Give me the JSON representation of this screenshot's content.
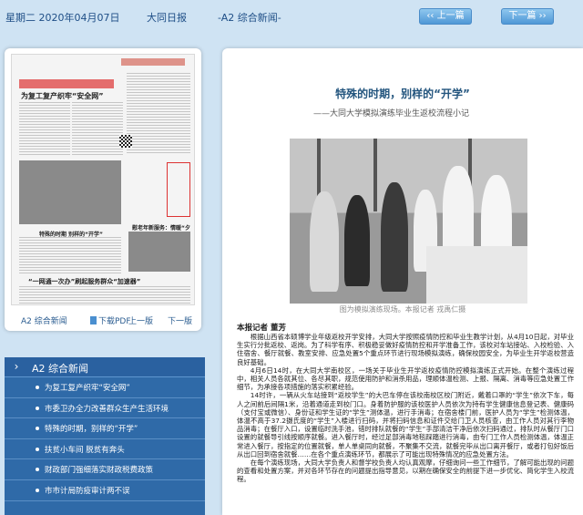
{
  "topbar": {
    "date": "星期二 2020年04月07日",
    "paper": "大同日报",
    "section": "-A2 综合新闻-",
    "prev_label": "上一篇",
    "next_label": "下一篇"
  },
  "thumbnail": {
    "page_name": "A2 综合新闻",
    "pdf_label": "下载PDF",
    "prev_page": "上一版",
    "next_page": "下一版",
    "headlines": [
      "为复工复产织牢“安全网”",
      "“一网通一次办”刷起服务群众“加速器”",
      "特殊的时期 别样的“开学”",
      "慰老年新服务：情暖“夕阳红”"
    ]
  },
  "sections": {
    "title": "A2 综合新闻",
    "items": [
      "为复工复产织牢“安全网”",
      "市委卫办全力改善群众生产生活环境",
      "特殊的时期，别样的“开学”",
      "扶贫小车间 脱贫有奔头",
      "财政部门强细落实财政税费政策",
      "市市计局防疫审计两不误"
    ]
  },
  "article": {
    "title": "特殊的时期，别样的“开学”",
    "subtitle": "——大同大学模拟演练毕业生返校流程小记",
    "caption": "图为模拟演练现场。本报记者 戎禹仁摄",
    "byline": "本报记者 董芳",
    "paragraphs": [
      "根据山西省本硕博学业年级返校开学安排，大同大学按照疫情防控和毕业生教学计划，从4月10日起，对毕业生实行分批返校、返岗。为了科学有序、积极稳妥做好疫情防控和开学准备工作，该校对车站接站、入校检验、入住宿舍、餐厅就餐、教室安排、应急处置5个重点环节进行现场模拟演练，确保校园安全，为毕业生开学返校营造良好基础。",
      "4月6日14时，在大同大学南校区，一场关于毕业生开学返校疫情防控模拟演练正式开始。在整个演练过程中，相关人员各就其位、各尽其职，规范使用防护和消杀用品，理顺体温检测、上报、隔离、消毒等应急处置工作细节，为承接各项措施的落实积累经验。",
      "14时许，一辆从火车站接到“返校学生”的大巴车停在该校南校区校门附近，戴着口罩的“学生”依次下车，每人之间前后间隔1米，沿着通道走到校门口。身着防护服的该校医护人员依次为持有学生健康信息登记表、健康码（支付宝或微信）、身份证和学生证的“学生”测体温，进行手消毒；在宿舍楼门前，医护人员为“学生”检测体温，体温不高于37.2摄氏度的“学生”入楼进行扫码，并将扫码信息和证件交给门卫人员核查，由工作人员对其行李物品消毒；在餐厅入口，设置临时洗手池，错时排队就餐的“学生”手部清洁干净后依次扫码通过，排队时从餐厅门口设置的就餐导引线按顺序就餐。进入餐厅时，经过足部消毒地毯踩踏进行消毒，由专门工作人员检测体温，体温正常进入餐厅，按指定的位置就餐，单人单桌同向就餐，不聚集不交流，就餐完毕从出口离开餐厅，或者打包好饭后从出口回到宿舍就餐……在各个重点演练环节，都展示了可能出现特殊情况的应急处置方法。",
      "在每个演练现场，大同大学负责人和督学校负责人均认真观摩，仔细询问一些工作细节，了解可能出现的问题的查看和处置方案，并对各环节存在的问题提出指导意见，以期在确保安全的前提下进一步优化、简化学生入校流程。"
    ]
  }
}
